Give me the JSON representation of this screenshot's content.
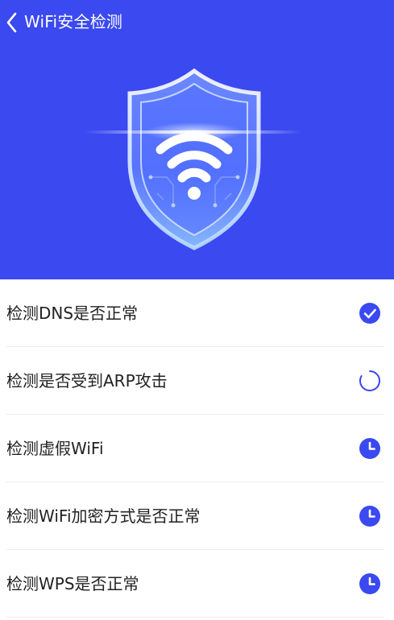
{
  "header": {
    "title": "WiFi安全检测",
    "background_color": "#3a49f0"
  },
  "checks": [
    {
      "label": "检测DNS是否正常",
      "status": "done",
      "icon": "check-circle-icon"
    },
    {
      "label": "检测是否受到ARP攻击",
      "status": "in-progress",
      "icon": "loading-spinner-icon"
    },
    {
      "label": "检测虚假WiFi",
      "status": "pending",
      "icon": "clock-icon"
    },
    {
      "label": "检测WiFi加密方式是否正常",
      "status": "pending",
      "icon": "clock-icon"
    },
    {
      "label": "检测WPS是否正常",
      "status": "pending",
      "icon": "clock-icon"
    }
  ],
  "colors": {
    "accent": "#3a49f0",
    "text": "#222222",
    "divider": "#ececec"
  }
}
